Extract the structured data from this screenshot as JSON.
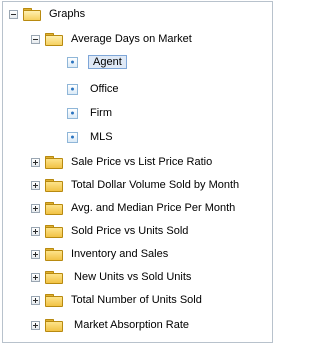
{
  "tree": {
    "root": {
      "label": "Graphs"
    },
    "open_group": {
      "label": "Average Days on Market",
      "children": [
        "Agent",
        "Office",
        "Firm",
        "MLS"
      ],
      "selected": "Agent"
    },
    "collapsed_groups": [
      "Sale Price vs List Price Ratio",
      "Total Dollar Volume Sold by Month",
      "Avg. and Median Price Per Month",
      "Sold Price vs Units Sold",
      "Inventory and Sales",
      " New Units vs Sold Units",
      "Total Number of Units Sold",
      " Market Absorption Rate"
    ]
  },
  "icons": {
    "expander_open": "minus-box-icon",
    "expander_closed": "plus-box-icon",
    "folder": "folder-icon",
    "report": "report-icon"
  },
  "colors": {
    "folder": "#f1c244",
    "selection": "#dfe9f6",
    "selection_border": "#7ea6d8"
  }
}
